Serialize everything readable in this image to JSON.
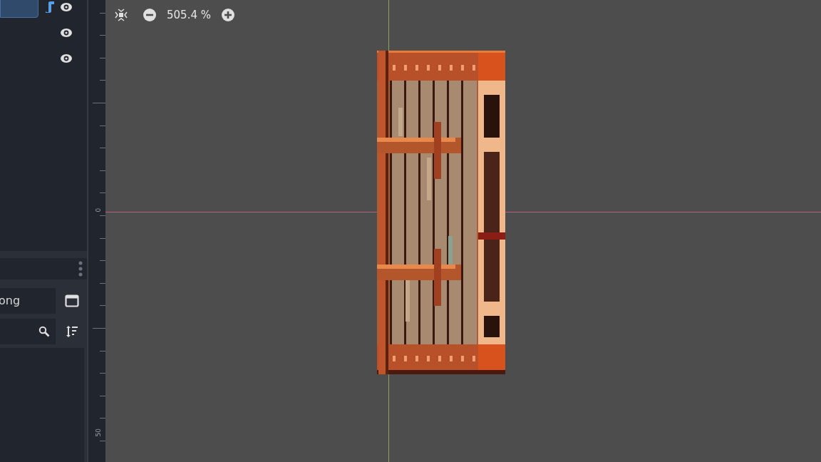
{
  "scene_tree": {
    "rows": [
      {
        "selected": true,
        "has_script": true,
        "visible": true
      },
      {
        "selected": false,
        "has_script": false,
        "visible": true
      },
      {
        "selected": false,
        "has_script": false,
        "visible": true
      }
    ]
  },
  "filesystem": {
    "path": "ong"
  },
  "ruler": {
    "labels": [
      "0",
      "50"
    ]
  },
  "canvas_toolbar": {
    "zoom": "505.4 %"
  }
}
